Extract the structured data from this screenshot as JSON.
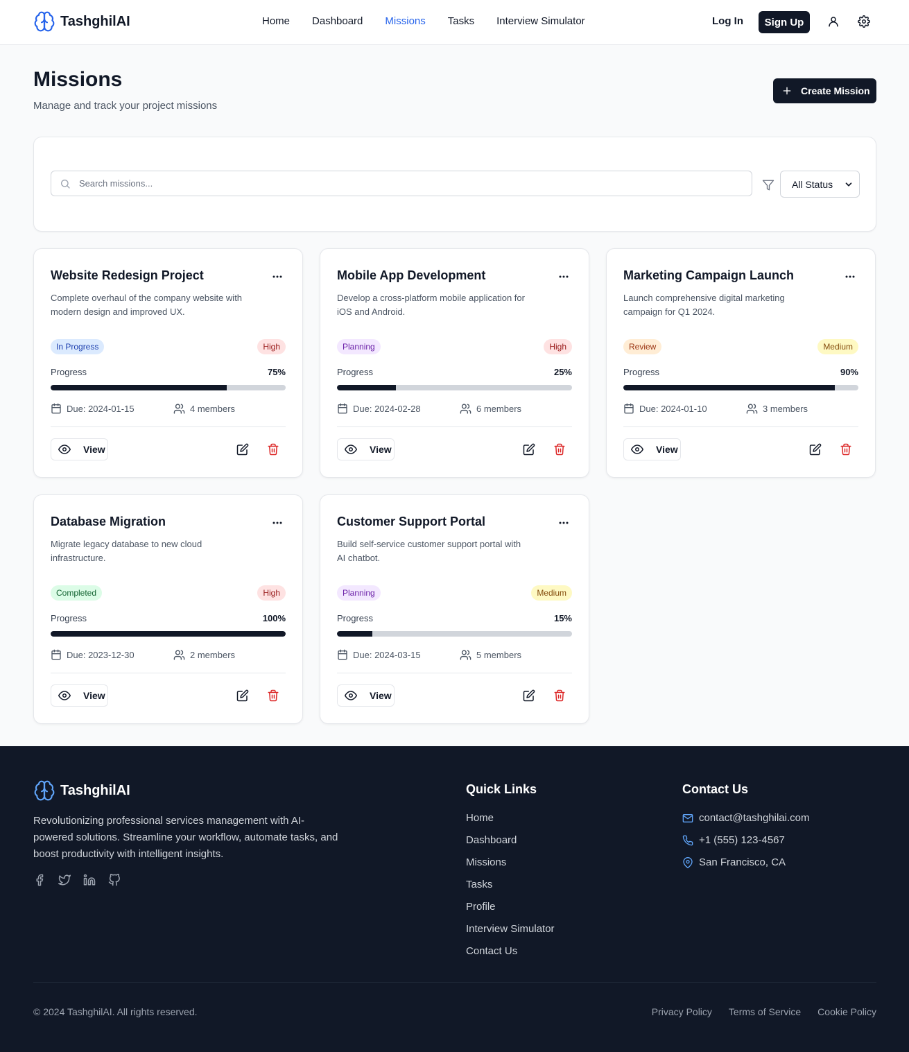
{
  "brand": {
    "name": "TashghilAI"
  },
  "nav": {
    "home": "Home",
    "dashboard": "Dashboard",
    "missions": "Missions",
    "tasks": "Tasks",
    "interview": "Interview Simulator"
  },
  "auth": {
    "login": "Log In",
    "signup": "Sign Up"
  },
  "page": {
    "title": "Missions",
    "subtitle": "Manage and track your project missions",
    "create_label": "Create Mission"
  },
  "filters": {
    "search_placeholder": "Search missions...",
    "status_selected": "All Status"
  },
  "labels": {
    "progress": "Progress",
    "view": "View"
  },
  "colors": {
    "accent": "#2563eb",
    "dark": "#111827",
    "danger": "#dc2626"
  },
  "missions": [
    {
      "title": "Website Redesign Project",
      "description": "Complete overhaul of the company website with modern design and improved UX.",
      "status": "In Progress",
      "priority": "High",
      "progress": 75,
      "progress_text": "75%",
      "due": "Due: 2024-01-15",
      "members": "4 members"
    },
    {
      "title": "Mobile App Development",
      "description": "Develop a cross-platform mobile application for iOS and Android.",
      "status": "Planning",
      "priority": "High",
      "progress": 25,
      "progress_text": "25%",
      "due": "Due: 2024-02-28",
      "members": "6 members"
    },
    {
      "title": "Marketing Campaign Launch",
      "description": "Launch comprehensive digital marketing campaign for Q1 2024.",
      "status": "Review",
      "priority": "Medium",
      "progress": 90,
      "progress_text": "90%",
      "due": "Due: 2024-01-10",
      "members": "3 members"
    },
    {
      "title": "Database Migration",
      "description": "Migrate legacy database to new cloud infrastructure.",
      "status": "Completed",
      "priority": "High",
      "progress": 100,
      "progress_text": "100%",
      "due": "Due: 2023-12-30",
      "members": "2 members"
    },
    {
      "title": "Customer Support Portal",
      "description": "Build self-service customer support portal with AI chatbot.",
      "status": "Planning",
      "priority": "Medium",
      "progress": 15,
      "progress_text": "15%",
      "due": "Due: 2024-03-15",
      "members": "5 members"
    }
  ],
  "footer": {
    "brand": "TashghilAI",
    "description": "Revolutionizing professional services management with AI-powered solutions. Streamline your workflow, automate tasks, and boost productivity with intelligent insights.",
    "quick_links_title": "Quick Links",
    "quick_links": [
      "Home",
      "Dashboard",
      "Missions",
      "Tasks",
      "Profile",
      "Interview Simulator",
      "Contact Us"
    ],
    "contact_title": "Contact Us",
    "email": "contact@tashghilai.com",
    "phone": "+1 (555) 123-4567",
    "location": "San Francisco, CA",
    "copyright": "© 2024 TashghilAI. All rights reserved.",
    "privacy": "Privacy Policy",
    "terms": "Terms of Service",
    "cookie": "Cookie Policy"
  }
}
